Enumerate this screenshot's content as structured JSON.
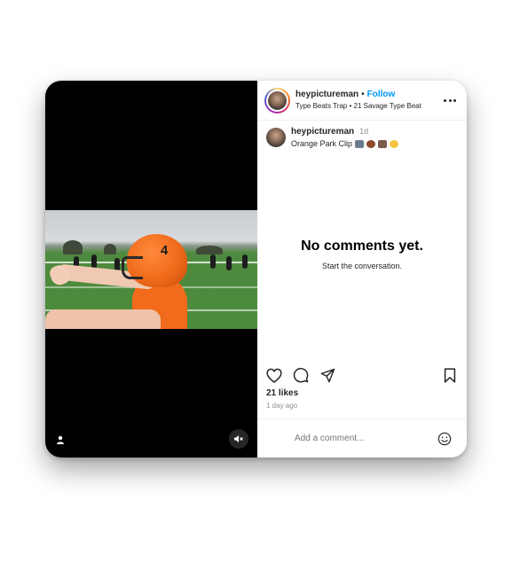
{
  "post": {
    "username": "heypictureman",
    "separator": "•",
    "follow_label": "Follow",
    "audio": "Type Beats Trap • 21 Savage Type Beat"
  },
  "caption": {
    "username": "heypictureman",
    "time": "1d",
    "text": "Orange Park Clip",
    "emoji_icons": [
      "camera-emoji",
      "football-emoji",
      "group-emoji",
      "flexed-biceps-emoji"
    ]
  },
  "comments": {
    "empty_title": "No comments yet.",
    "empty_subtitle": "Start the conversation."
  },
  "stats": {
    "likes": "21 likes",
    "posted_ago": "1 day ago"
  },
  "comment_box": {
    "placeholder": "Add a comment..."
  },
  "media": {
    "muted": true,
    "video_subject": "football player in orange helmet number 4"
  },
  "colors": {
    "follow": "#0095f6",
    "text": "#262626",
    "muted_text": "#8e8e8e",
    "helmet": "#f06a1a"
  }
}
